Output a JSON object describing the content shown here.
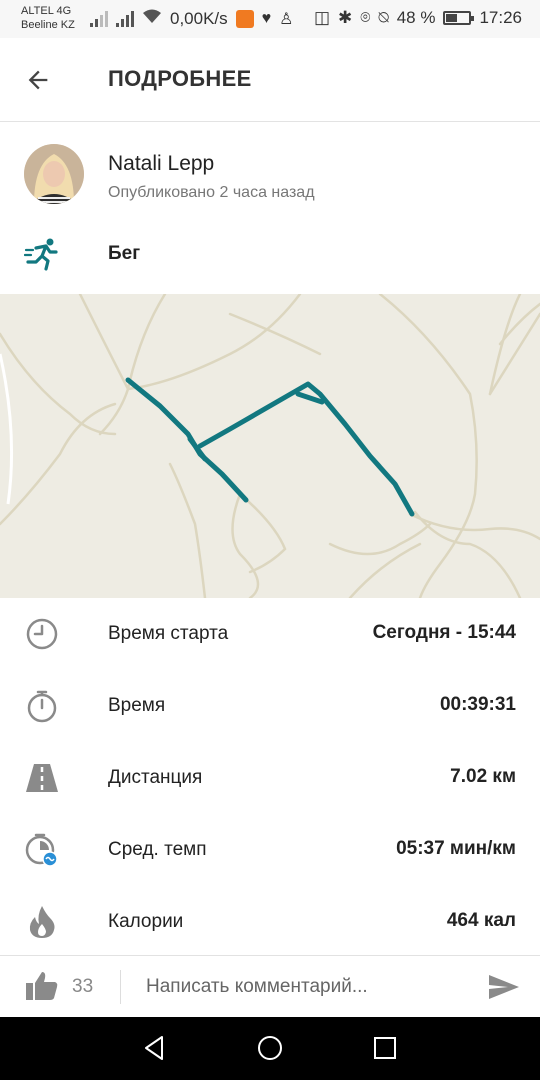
{
  "status_bar": {
    "carrier_1": "ALTEL 4G",
    "carrier_2": "Beeline KZ",
    "net_speed": "0,00K/s",
    "battery": "48 %",
    "battery_level": 0.48,
    "time": "17:26"
  },
  "header": {
    "title": "ПОДРОБНЕЕ",
    "back_icon": "arrow-left-icon"
  },
  "author": {
    "name": "Natali Lepp",
    "published": "Опубликовано 2 часа назад"
  },
  "activity": {
    "type_label": "Бег",
    "icon": "running-icon"
  },
  "colors": {
    "accent": "#127880",
    "map_bg": "#eeece3",
    "road": "#dcd6bf",
    "icon_gray": "#8a8a8a"
  },
  "stats": [
    {
      "icon": "clock-icon",
      "label": "Время старта",
      "value": "Сегодня - 15:44"
    },
    {
      "icon": "stopwatch-icon",
      "label": "Время",
      "value": "00:39:31"
    },
    {
      "icon": "road-icon",
      "label": "Дистанция",
      "value": "7.02 км"
    },
    {
      "icon": "pace-icon",
      "label": "Сред. темп",
      "value": "05:37 мин/км"
    },
    {
      "icon": "flame-icon",
      "label": "Калории",
      "value": "464 кал"
    }
  ],
  "comment_bar": {
    "like_icon": "thumbs-up-icon",
    "like_count": "33",
    "placeholder": "Написать комментарий...",
    "send_icon": "send-icon"
  },
  "nav_bar": {
    "back_icon": "nav-back-icon",
    "home_icon": "nav-home-icon",
    "recents_icon": "nav-recents-icon"
  }
}
